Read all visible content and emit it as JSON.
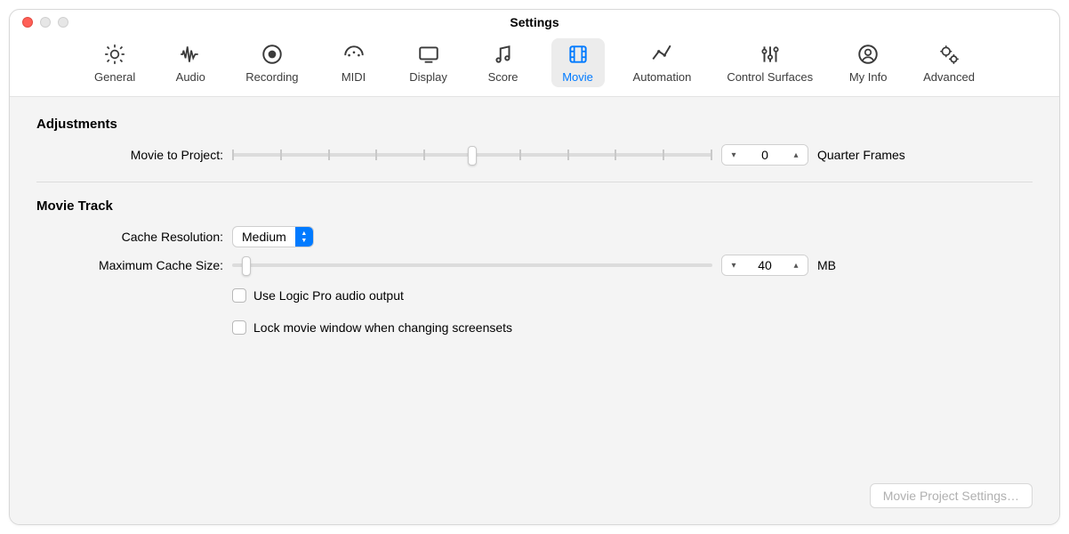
{
  "window": {
    "title": "Settings"
  },
  "toolbar": {
    "items": [
      {
        "key": "general",
        "label": "General"
      },
      {
        "key": "audio",
        "label": "Audio"
      },
      {
        "key": "recording",
        "label": "Recording"
      },
      {
        "key": "midi",
        "label": "MIDI"
      },
      {
        "key": "display",
        "label": "Display"
      },
      {
        "key": "score",
        "label": "Score"
      },
      {
        "key": "movie",
        "label": "Movie"
      },
      {
        "key": "automation",
        "label": "Automation"
      },
      {
        "key": "control-surfaces",
        "label": "Control Surfaces"
      },
      {
        "key": "my-info",
        "label": "My Info"
      },
      {
        "key": "advanced",
        "label": "Advanced"
      }
    ],
    "selected": "movie"
  },
  "sections": {
    "adjustments": {
      "title": "Adjustments",
      "movie_to_project": {
        "label": "Movie to Project:",
        "value": "0",
        "unit": "Quarter Frames",
        "slider_pos_percent": 50
      }
    },
    "movie_track": {
      "title": "Movie Track",
      "cache_resolution": {
        "label": "Cache Resolution:",
        "value": "Medium"
      },
      "max_cache_size": {
        "label": "Maximum Cache Size:",
        "value": "40",
        "unit": "MB",
        "slider_pos_percent": 3
      },
      "checkboxes": {
        "use_audio_output": {
          "label": "Use Logic Pro audio output",
          "checked": false
        },
        "lock_window": {
          "label": "Lock movie window when changing screensets",
          "checked": false
        }
      }
    }
  },
  "footer": {
    "button": "Movie Project Settings…"
  }
}
